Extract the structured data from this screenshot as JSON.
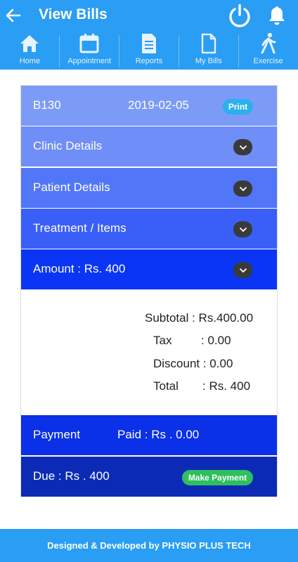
{
  "header": {
    "title": "View Bills",
    "back_icon": "arrow-left-icon",
    "power_icon": "power-icon",
    "bell_icon": "bell-icon",
    "color": "#2a9df4"
  },
  "nav": {
    "items": [
      {
        "label": "Home",
        "icon": "home-icon"
      },
      {
        "label": "Appointment",
        "icon": "calendar-icon"
      },
      {
        "label": "Reports",
        "icon": "report-icon"
      },
      {
        "label": "My Bills",
        "icon": "document-icon"
      },
      {
        "label": "Exercise",
        "icon": "walking-icon"
      }
    ]
  },
  "bill": {
    "id": "B130",
    "date": "2019-02-05",
    "print_label": "Print",
    "sections": {
      "clinic": "Clinic Details",
      "patient": "Patient Details",
      "treatment": "Treatment / Items",
      "amount": "Amount : Rs. 400"
    },
    "summary": {
      "subtotal": "Subtotal : Rs.400.00",
      "tax_label": "Tax",
      "tax_value": ": 0.00",
      "discount": "Discount : 0.00",
      "total_label": "Total",
      "total_value": ": Rs. 400"
    },
    "payment": {
      "label": "Payment",
      "paid": "Paid : Rs . 0.00"
    },
    "due": {
      "label": "Due : Rs . 400",
      "make_payment_label": "Make Payment"
    }
  },
  "footer": {
    "text": "Designed & Developed by PHYSIO PLUS TECH"
  }
}
